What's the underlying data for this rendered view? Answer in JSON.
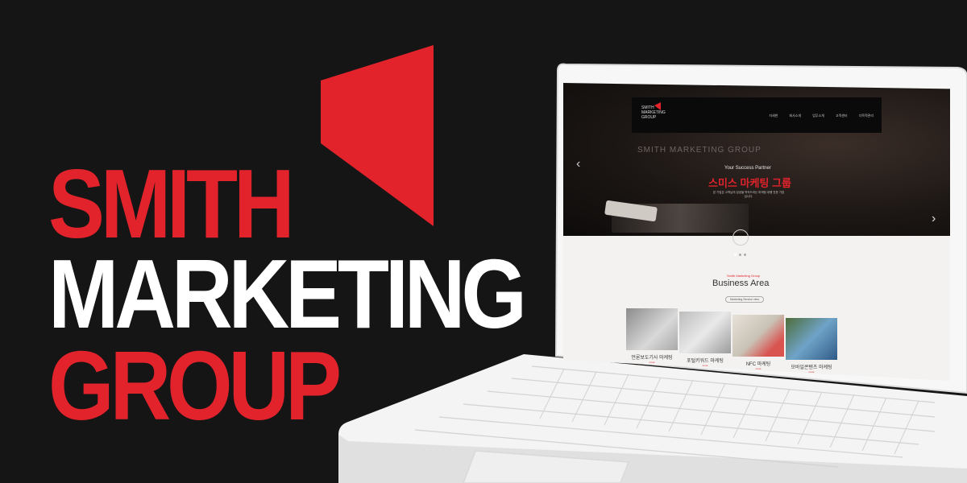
{
  "brand": {
    "line1": "SMITH",
    "line2": "MARKETING",
    "line3": "GROUP",
    "accent": "#e3232b",
    "background": "#161516"
  },
  "site": {
    "logo_text": "SMITH MARKETING GROUP",
    "nav": [
      "자세한",
      "회사소개",
      "업무소개",
      "고객센터",
      "다목적관리"
    ],
    "hero": {
      "watermark": "SMITH MARKETING GROUP",
      "tagline": "Your Success Partner",
      "title": "스미스 마케팅 그룹",
      "description": "본 기업은 고객님의 성공을 약속드리는 마케팅 대행 전문 기업입니다.",
      "prev_icon": "chevron-left-icon",
      "next_icon": "chevron-right-icon",
      "scroll_icon": "chevron-down-icon",
      "scroll_glyph": "⌄",
      "slides": 3,
      "active_slide": 1
    },
    "section": {
      "eyebrow": "Smith Marketing Group",
      "title": "Business Area",
      "pill": "Marketing Service view"
    },
    "cards": [
      {
        "label": "언론보도기사 마케팅",
        "more": "more"
      },
      {
        "label": "포털키워드 마케팅",
        "more": "more"
      },
      {
        "label": "NFC 마케팅",
        "more": "more"
      },
      {
        "label": "모바일콘텐츠 마케팅",
        "more": "more"
      }
    ]
  }
}
